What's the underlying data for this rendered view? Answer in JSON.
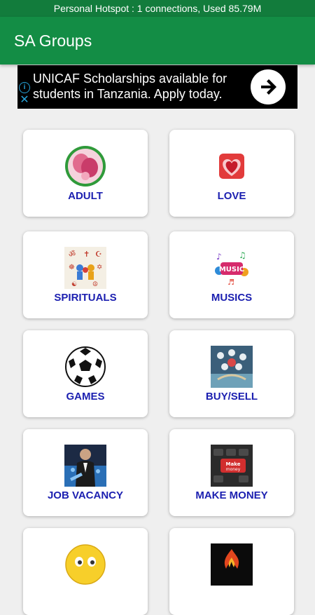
{
  "status_bar": {
    "text": "Personal Hotspot : 1 connections, Used 85.79M"
  },
  "app_bar": {
    "title": "SA Groups"
  },
  "ad": {
    "text": "UNICAF Scholarships available for students in Tanzania. Apply today.",
    "info_icon": "info-icon",
    "close_icon": "close-icon",
    "action_icon": "arrow-right-icon"
  },
  "categories": [
    {
      "label": "ADULT",
      "icon": "adult-photo-icon"
    },
    {
      "label": "LOVE",
      "icon": "hearts-icon"
    },
    {
      "label": "SPIRITUALS",
      "icon": "religion-symbols-icon"
    },
    {
      "label": "MUSICS",
      "icon": "music-icon"
    },
    {
      "label": "GAMES",
      "icon": "soccer-ball-icon"
    },
    {
      "label": "BUY/SELL",
      "icon": "marketplace-icon"
    },
    {
      "label": "JOB VACANCY",
      "icon": "businessman-icon"
    },
    {
      "label": "MAKE MONEY",
      "icon": "keyboard-money-icon"
    },
    {
      "label": "",
      "icon": "emoji-icon"
    },
    {
      "label": "",
      "icon": "fire-dark-icon"
    }
  ],
  "colors": {
    "status_bar": "#127c3c",
    "app_bar": "#138d45",
    "label": "#1b1fb0",
    "background": "#efefef"
  }
}
